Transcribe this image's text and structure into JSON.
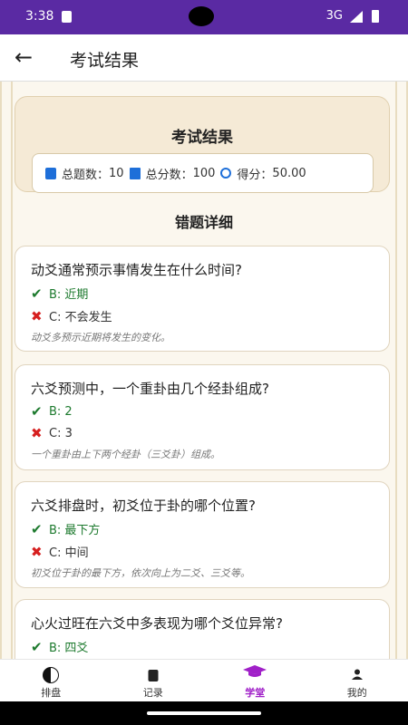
{
  "status_bar": {
    "time": "3:38",
    "network": "3G"
  },
  "app_bar": {
    "back_icon": "arrow-left-icon",
    "title": "考试结果"
  },
  "summary": {
    "title": "考试结果",
    "total_questions_label": "总题数：",
    "total_questions_value": "10",
    "total_score_label": "总分数：",
    "total_score_value": "100",
    "score_label": "得分：",
    "score_value": "50.00"
  },
  "wrong_section": {
    "title": "错题详细"
  },
  "questions": [
    {
      "question": "动爻通常预示事情发生在什么时间?",
      "correct": "B: 近期",
      "chosen": "C: 不会发生",
      "explanation": "动爻多预示近期将发生的变化。"
    },
    {
      "question": "六爻预测中，一个重卦由几个经卦组成?",
      "correct": "B: 2",
      "chosen": "C: 3",
      "explanation": "一个重卦由上下两个经卦（三爻卦）组成。"
    },
    {
      "question": "六爻排盘时，初爻位于卦的哪个位置?",
      "correct": "B: 最下方",
      "chosen": "C: 中间",
      "explanation": "初爻位于卦的最下方，依次向上为二爻、三爻等。"
    },
    {
      "question": "心火过旺在六爻中多表现为哪个爻位异常?",
      "correct": "B: 四爻"
    }
  ],
  "marks": {
    "correct": "✔",
    "wrong": "✖"
  },
  "bottom_nav": [
    {
      "label": "排盘",
      "icon": "yin-yang-icon"
    },
    {
      "label": "记录",
      "icon": "document-icon"
    },
    {
      "label": "学堂",
      "icon": "graduation-cap-icon",
      "active": true
    },
    {
      "label": "我的",
      "icon": "user-icon"
    }
  ],
  "colors": {
    "status_bar": "#5a2aa3",
    "accent": "#a020c8",
    "correct": "#1d7a2e",
    "wrong": "#d61f1f",
    "icon_blue": "#1e6fd9"
  }
}
